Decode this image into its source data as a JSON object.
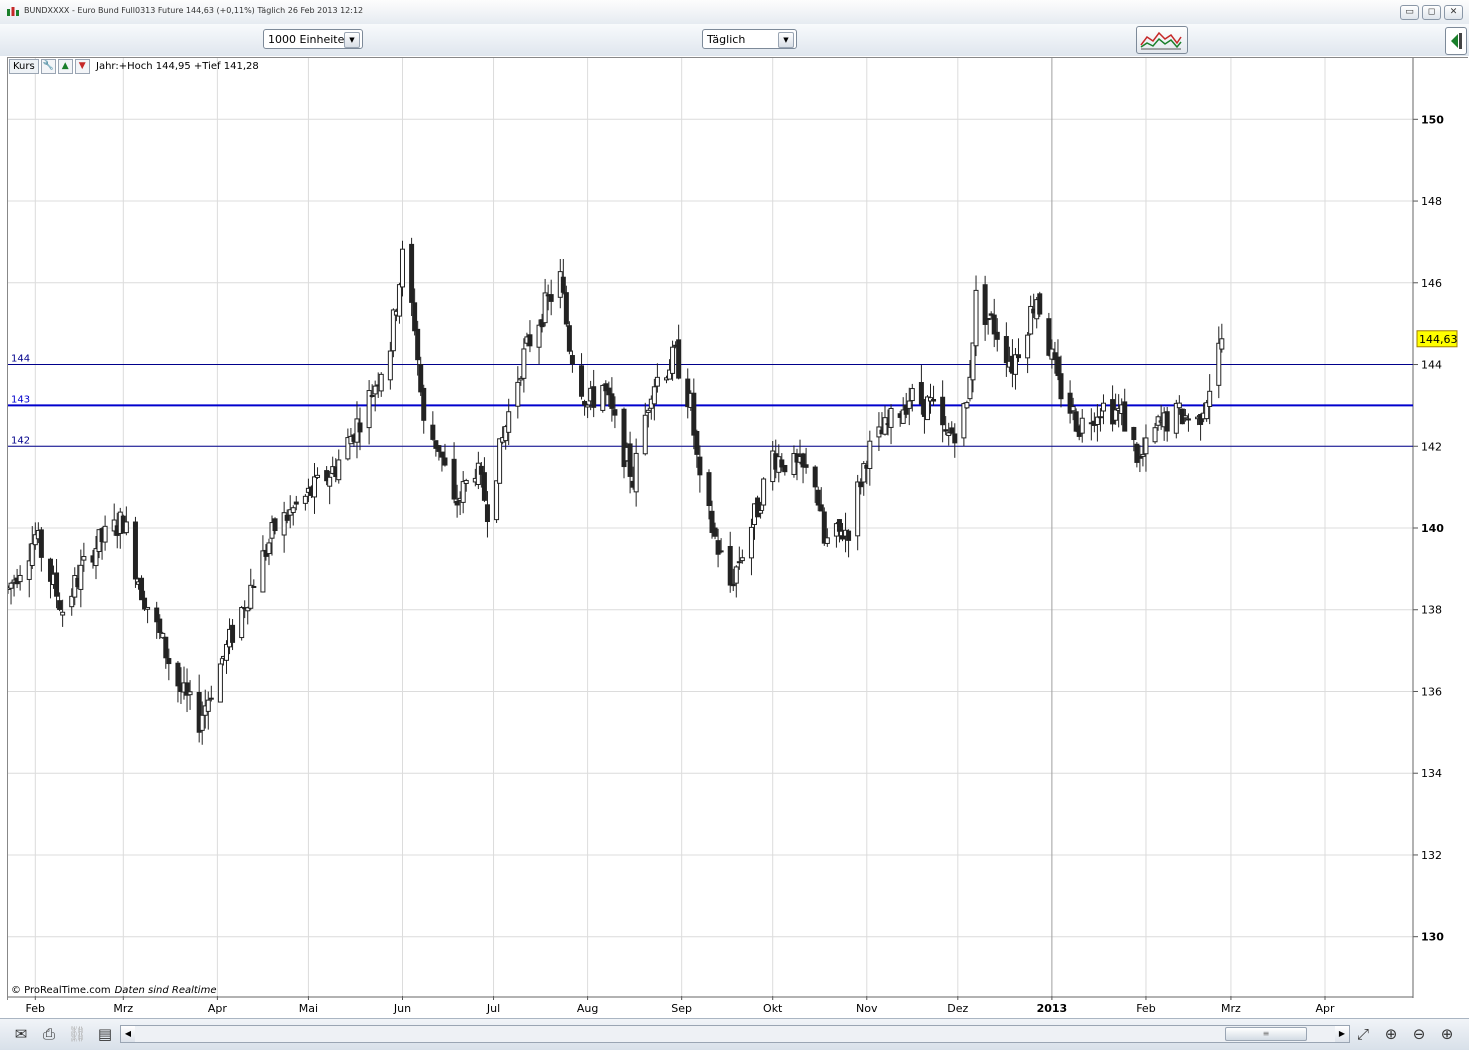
{
  "window": {
    "title": "BUNDXXXX - Euro Bund Full0313 Future   144,63 (+0,11%)   Täglich  26 Feb 2013 12:12",
    "buttons": [
      "▭",
      "◻",
      "✕"
    ]
  },
  "toolbar": {
    "units_select": "1000 Einheiten",
    "period_select": "Täglich"
  },
  "panel": {
    "label": "Kurs",
    "range_text": "Jahr:+Hoch 144,95 +Tief 141,28"
  },
  "footer": {
    "copyright": "© ProRealTime.com",
    "realtime": "Daten sind Realtime"
  },
  "chart_data": {
    "type": "candlestick",
    "y_axis": {
      "ticks": [
        130,
        132,
        134,
        136,
        138,
        140,
        142,
        144,
        146,
        148,
        150
      ],
      "bold_ticks": [
        130,
        140,
        150
      ],
      "range": [
        128.5,
        151.5
      ]
    },
    "x_axis": {
      "labels": [
        "Feb",
        "Mrz",
        "Apr",
        "Mai",
        "Jun",
        "Jul",
        "Aug",
        "Sep",
        "Okt",
        "Nov",
        "Dez",
        "2013",
        "Feb",
        "Mrz",
        "Apr"
      ],
      "bold_labels": [
        "2013"
      ],
      "range": [
        "2012-01-23",
        "2013-04-30"
      ],
      "label_dates": [
        "2012-02-01",
        "2012-03-01",
        "2012-04-01",
        "2012-05-01",
        "2012-06-01",
        "2012-07-01",
        "2012-08-01",
        "2012-09-01",
        "2012-10-01",
        "2012-11-01",
        "2012-12-01",
        "2013-01-01",
        "2013-02-01",
        "2013-03-01",
        "2013-04-01"
      ]
    },
    "horizontal_lines": [
      {
        "label": "144",
        "value": 144,
        "color": "#00008b",
        "bold": false
      },
      {
        "label": "143",
        "value": 143,
        "color": "#0000cd",
        "bold": true
      },
      {
        "label": "142",
        "value": 142,
        "color": "#00008b",
        "bold": false
      }
    ],
    "last_price": "144,63",
    "last_value": 144.63,
    "grid": true,
    "anchors": [
      [
        "2012-01-23",
        138.5
      ],
      [
        "2012-02-01",
        139.8
      ],
      [
        "2012-02-10",
        138.0
      ],
      [
        "2012-02-20",
        139.5
      ],
      [
        "2012-03-01",
        140.2
      ],
      [
        "2012-03-07",
        138.5
      ],
      [
        "2012-03-20",
        136.0
      ],
      [
        "2012-03-26",
        135.3
      ],
      [
        "2012-04-10",
        138.2
      ],
      [
        "2012-04-20",
        140.0
      ],
      [
        "2012-05-01",
        140.8
      ],
      [
        "2012-05-10",
        141.5
      ],
      [
        "2012-05-20",
        143.0
      ],
      [
        "2012-05-28",
        144.5
      ],
      [
        "2012-06-01",
        146.6
      ],
      [
        "2012-06-05",
        145.0
      ],
      [
        "2012-06-08",
        142.5
      ],
      [
        "2012-06-13",
        142.0
      ],
      [
        "2012-06-18",
        140.5
      ],
      [
        "2012-06-25",
        141.5
      ],
      [
        "2012-06-29",
        140.5
      ],
      [
        "2012-07-05",
        142.5
      ],
      [
        "2012-07-10",
        144.0
      ],
      [
        "2012-07-15",
        145.0
      ],
      [
        "2012-07-23",
        146.1
      ],
      [
        "2012-07-26",
        144.5
      ],
      [
        "2012-08-01",
        143.0
      ],
      [
        "2012-08-06",
        143.5
      ],
      [
        "2012-08-10",
        142.5
      ],
      [
        "2012-08-16",
        141.2
      ],
      [
        "2012-08-22",
        143.5
      ],
      [
        "2012-08-30",
        144.2
      ],
      [
        "2012-09-04",
        143.0
      ],
      [
        "2012-09-07",
        141.0
      ],
      [
        "2012-09-13",
        139.5
      ],
      [
        "2012-09-17",
        138.6
      ],
      [
        "2012-09-26",
        140.5
      ],
      [
        "2012-10-01",
        141.8
      ],
      [
        "2012-10-08",
        141.5
      ],
      [
        "2012-10-15",
        141.2
      ],
      [
        "2012-10-18",
        139.6
      ],
      [
        "2012-10-26",
        140.0
      ],
      [
        "2012-11-01",
        141.8
      ],
      [
        "2012-11-08",
        142.5
      ],
      [
        "2012-11-15",
        143.2
      ],
      [
        "2012-11-22",
        143.0
      ],
      [
        "2012-11-27",
        142.2
      ],
      [
        "2012-12-01",
        142.5
      ],
      [
        "2012-12-04",
        143.0
      ],
      [
        "2012-12-07",
        145.6
      ],
      [
        "2012-12-14",
        144.8
      ],
      [
        "2012-12-19",
        144.0
      ],
      [
        "2012-12-27",
        145.7
      ],
      [
        "2013-01-03",
        143.5
      ],
      [
        "2013-01-10",
        142.5
      ],
      [
        "2013-01-17",
        143.0
      ],
      [
        "2013-01-24",
        142.8
      ],
      [
        "2013-01-30",
        141.6
      ],
      [
        "2013-02-05",
        142.5
      ],
      [
        "2013-02-12",
        142.8
      ],
      [
        "2013-02-18",
        142.6
      ],
      [
        "2013-02-22",
        143.5
      ],
      [
        "2013-02-26",
        144.63
      ]
    ]
  }
}
